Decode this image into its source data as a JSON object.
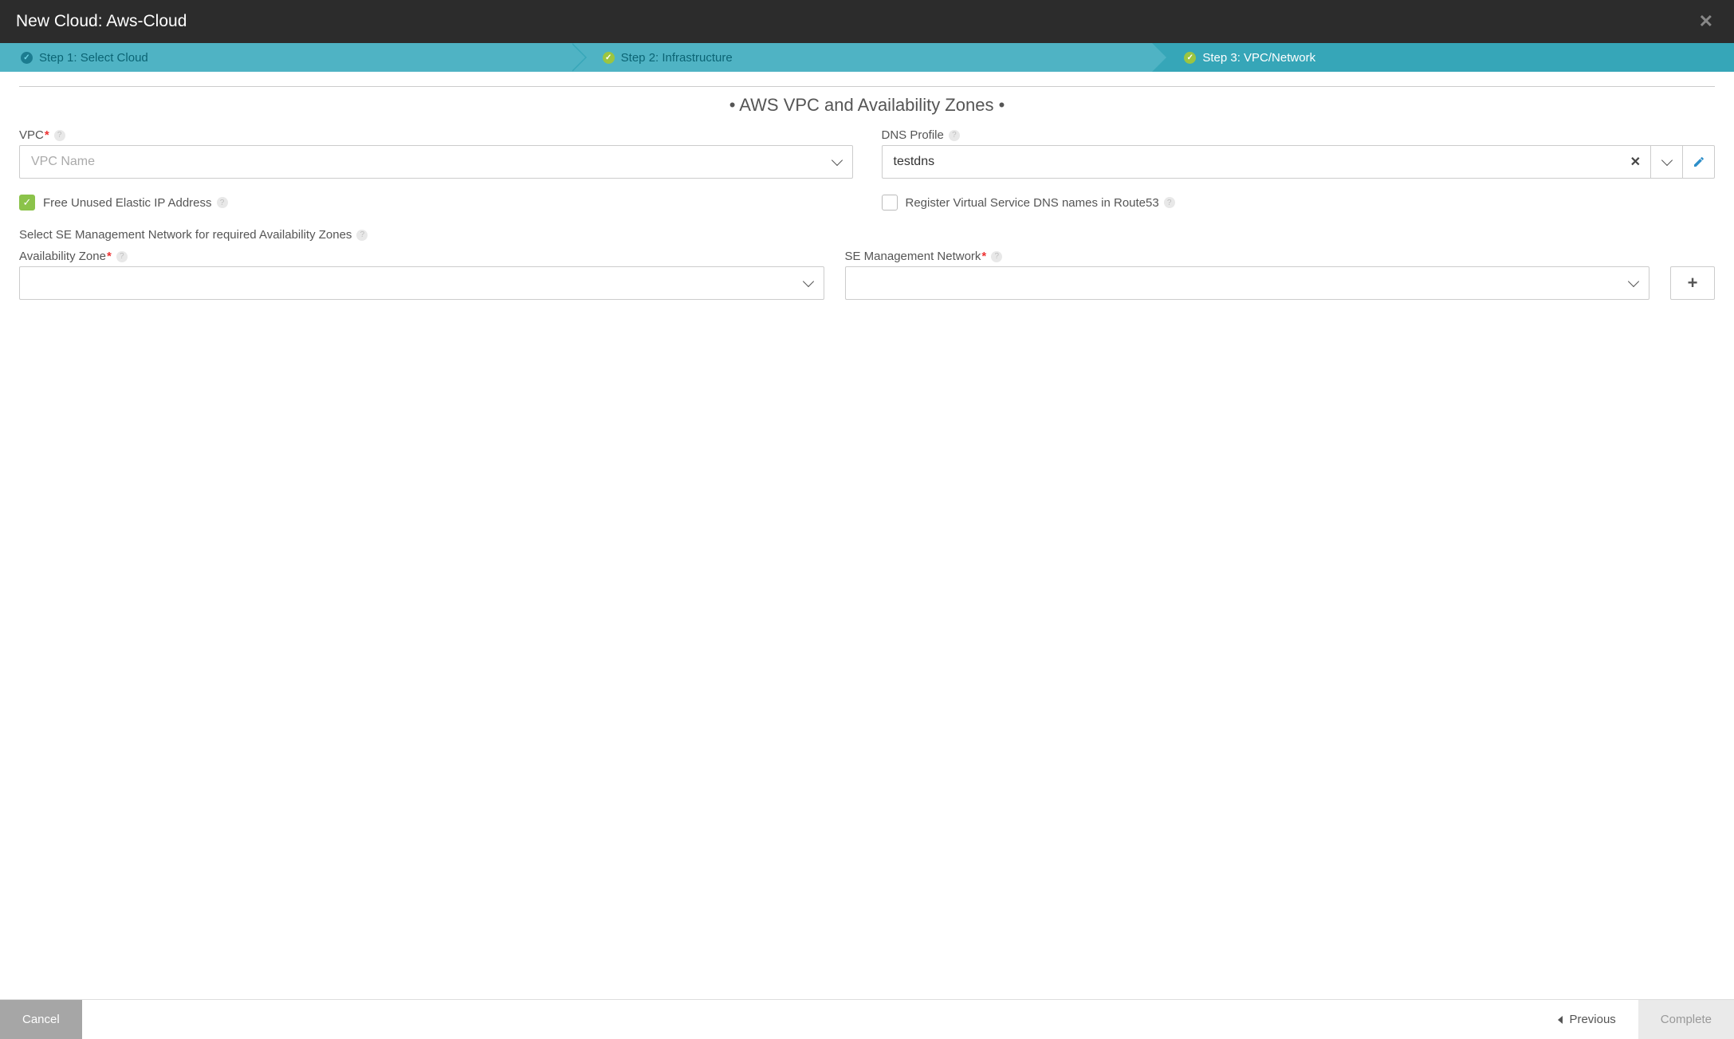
{
  "header": {
    "title": "New Cloud: Aws-Cloud"
  },
  "steps": {
    "s1": "Step 1: Select Cloud",
    "s2": "Step 2: Infrastructure",
    "s3": "Step 3: VPC/Network"
  },
  "section": {
    "title": "• AWS VPC and Availability Zones •"
  },
  "vpc": {
    "label": "VPC",
    "placeholder": "VPC Name",
    "value": ""
  },
  "dns": {
    "label": "DNS Profile",
    "value": "testdns"
  },
  "freeEip": {
    "label": "Free Unused Elastic IP Address",
    "checked": true
  },
  "route53": {
    "label": "Register Virtual Service DNS names in Route53",
    "checked": false
  },
  "selectSE": {
    "label": "Select SE Management Network for required Availability Zones"
  },
  "az": {
    "label": "Availability Zone",
    "value": ""
  },
  "seNet": {
    "label": "SE Management Network",
    "value": ""
  },
  "footer": {
    "cancel": "Cancel",
    "previous": "Previous",
    "complete": "Complete"
  }
}
